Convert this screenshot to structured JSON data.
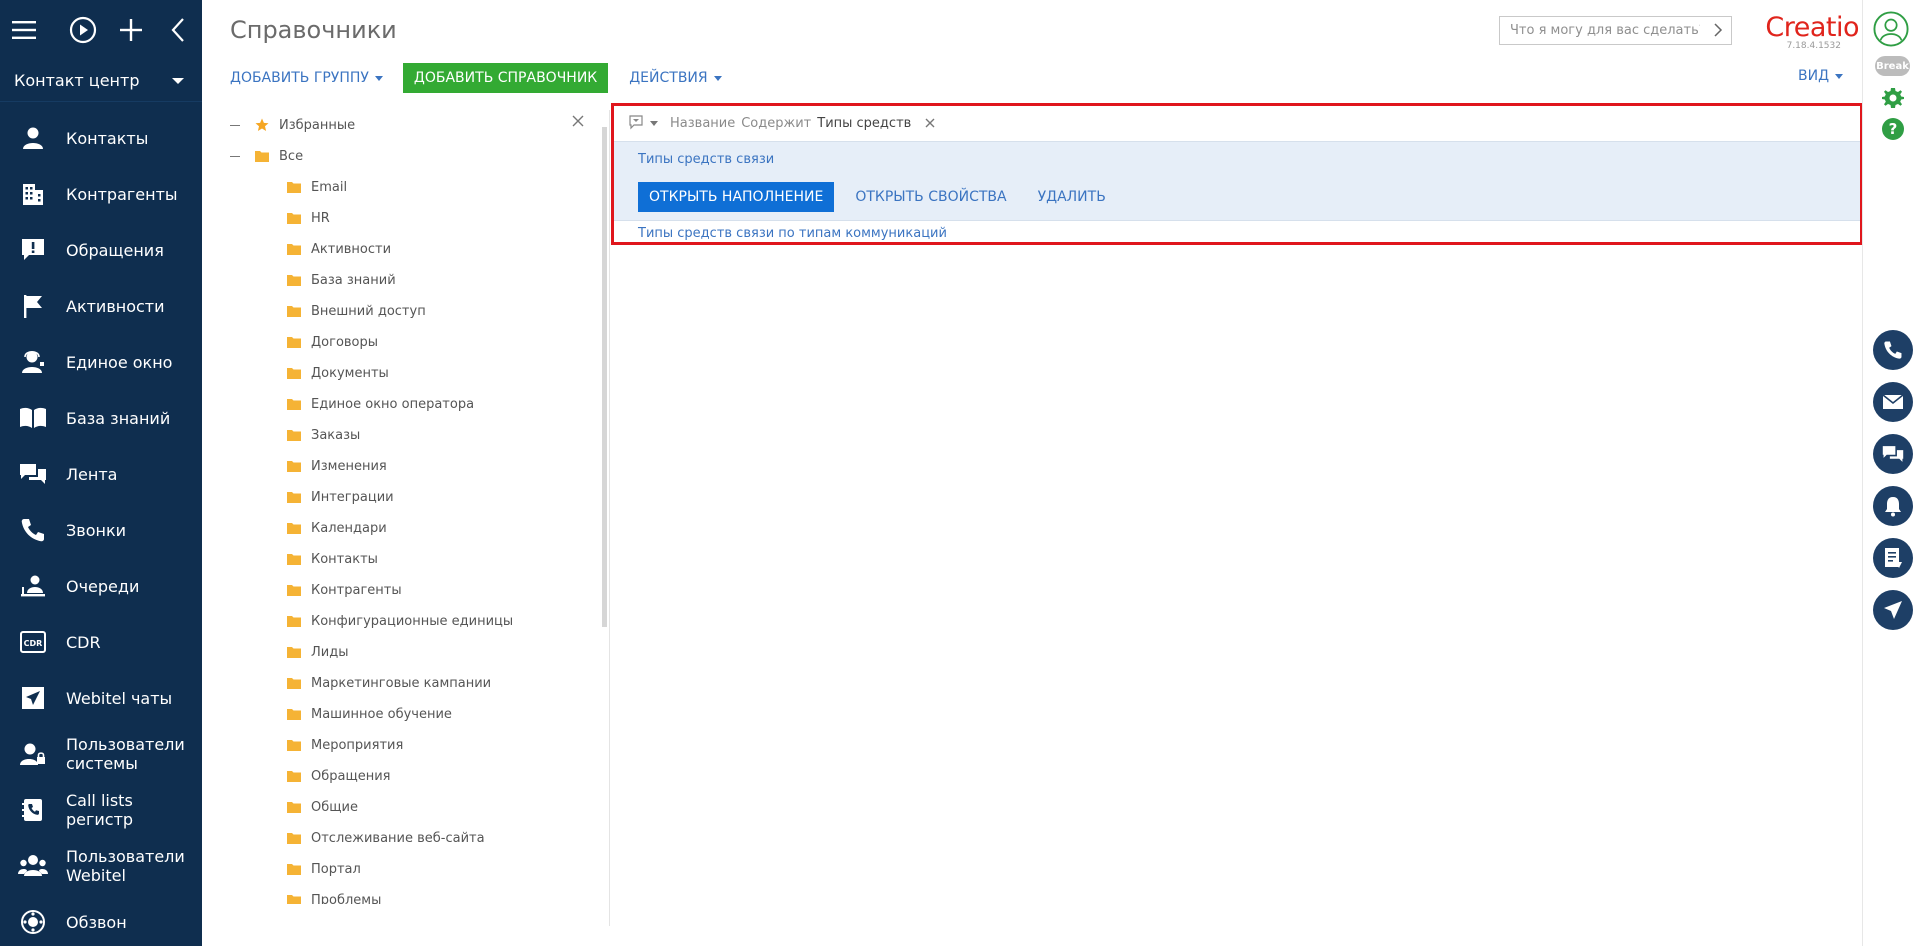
{
  "sidebar": {
    "workspace": "Контакт центр",
    "items": [
      {
        "label": "Контакты",
        "icon": "contact-person-icon"
      },
      {
        "label": "Контрагенты",
        "icon": "building-icon"
      },
      {
        "label": "Обращения",
        "icon": "case-alert-icon"
      },
      {
        "label": "Активности",
        "icon": "flag-icon"
      },
      {
        "label": "Единое окно",
        "icon": "agent-person-icon"
      },
      {
        "label": "База знаний",
        "icon": "open-book-icon"
      },
      {
        "label": "Лента",
        "icon": "feed-chat-icon"
      },
      {
        "label": "Звонки",
        "icon": "phone-icon"
      },
      {
        "label": "Очереди",
        "icon": "queue-people-icon"
      },
      {
        "label": "CDR",
        "icon": "cdr-icon"
      },
      {
        "label": "Webitel чаты",
        "icon": "send-icon"
      },
      {
        "label": "Пользователи системы",
        "icon": "user-lock-icon"
      },
      {
        "label": "Call lists регистр",
        "icon": "call-list-icon"
      },
      {
        "label": "Пользователи Webitel",
        "icon": "users-group-icon"
      },
      {
        "label": "Обзвон",
        "icon": "dialer-icon"
      }
    ]
  },
  "header": {
    "title": "Справочники",
    "search_placeholder": "Что я могу для вас сделать?",
    "brand": "Creatio",
    "version": "7.18.4.1532"
  },
  "toolbar": {
    "add_group": "Добавить группу",
    "add_lookup": "Добавить справочник",
    "actions": "Действия",
    "view": "Вид"
  },
  "tree": {
    "favorites": "Избранные",
    "all": "Все",
    "folders": [
      "Email",
      "HR",
      "Активности",
      "База знаний",
      "Внешний доступ",
      "Договоры",
      "Документы",
      "Единое окно оператора",
      "Заказы",
      "Изменения",
      "Интеграции",
      "Календари",
      "Контакты",
      "Контрагенты",
      "Конфигурационные единицы",
      "Лиды",
      "Маркетинговые кампании",
      "Машинное обучение",
      "Мероприятия",
      "Обращения",
      "Общие",
      "Отслеживание веб-сайта",
      "Портал",
      "Проблемы"
    ]
  },
  "filter": {
    "field": "Название",
    "operator": "Содержит",
    "value": "Типы средств"
  },
  "results": {
    "selected_name": "Типы средств связи",
    "open_content": "Открыть наполнение",
    "open_properties": "Открыть свойства",
    "delete": "Удалить",
    "second_name": "Типы средств связи по типам коммуникаций"
  },
  "rail": {
    "status": "Break"
  },
  "colors": {
    "sidebar_bg": "#0f2e4f",
    "accent_green": "#33aa33",
    "accent_blue": "#0f6fd6",
    "link": "#3b74c1",
    "brand_red": "#e0241c",
    "highlight_border": "#e0161c"
  }
}
